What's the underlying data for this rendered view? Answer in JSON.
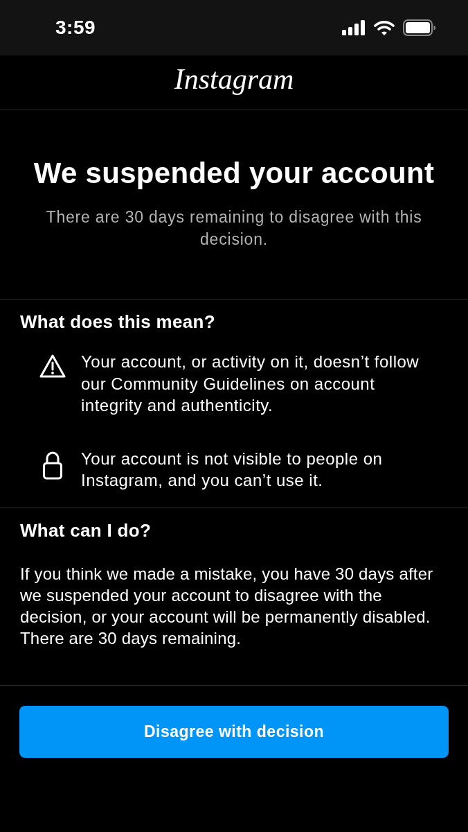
{
  "status_bar": {
    "time": "3:59"
  },
  "header": {
    "logo": "Instagram"
  },
  "hero": {
    "title": "We suspended your account",
    "subtitle": "There are 30 days remaining to disagree with this decision."
  },
  "sections": [
    {
      "heading": "What does this mean?",
      "items": [
        {
          "kind": "warning",
          "text": "Your account, or activity on it, doesn’t follow our Community Guidelines on account integrity and authenticity."
        },
        {
          "kind": "lock",
          "text": "Your account is not visible to people on Instagram, and you can’t use it."
        }
      ]
    },
    {
      "heading": "What can I do?",
      "paragraph": "If you think we made a mistake, you have 30 days after we suspended your account to disagree with the decision, or your account will be permanently disabled. There are 30 days remaining."
    }
  ],
  "button": {
    "label": "Disagree with decision"
  }
}
